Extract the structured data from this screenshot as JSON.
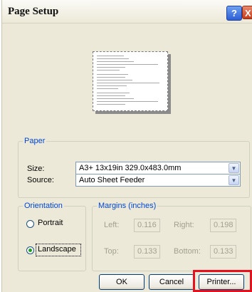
{
  "dialog": {
    "title": "Page Setup",
    "help_glyph": "?",
    "close_glyph": "X"
  },
  "paper": {
    "group_label": "Paper",
    "size_label": "Size:",
    "size_value": "A3+ 13x19in 329.0x483.0mm",
    "source_label": "Source:",
    "source_value": "Auto Sheet Feeder"
  },
  "orientation": {
    "group_label": "Orientation",
    "portrait_label": "Portrait",
    "landscape_label": "Landscape",
    "selected": "Landscape"
  },
  "margins": {
    "group_label": "Margins (inches)",
    "left_label": "Left:",
    "left_value": "0.116",
    "right_label": "Right:",
    "right_value": "0.198",
    "top_label": "Top:",
    "top_value": "0.133",
    "bottom_label": "Bottom:",
    "bottom_value": "0.133"
  },
  "buttons": {
    "ok": "OK",
    "cancel": "Cancel",
    "printer": "Printer..."
  },
  "colors": {
    "dialog_bg": "#ece9d8",
    "group_label": "#0046d5",
    "highlight": "#e8101c"
  }
}
